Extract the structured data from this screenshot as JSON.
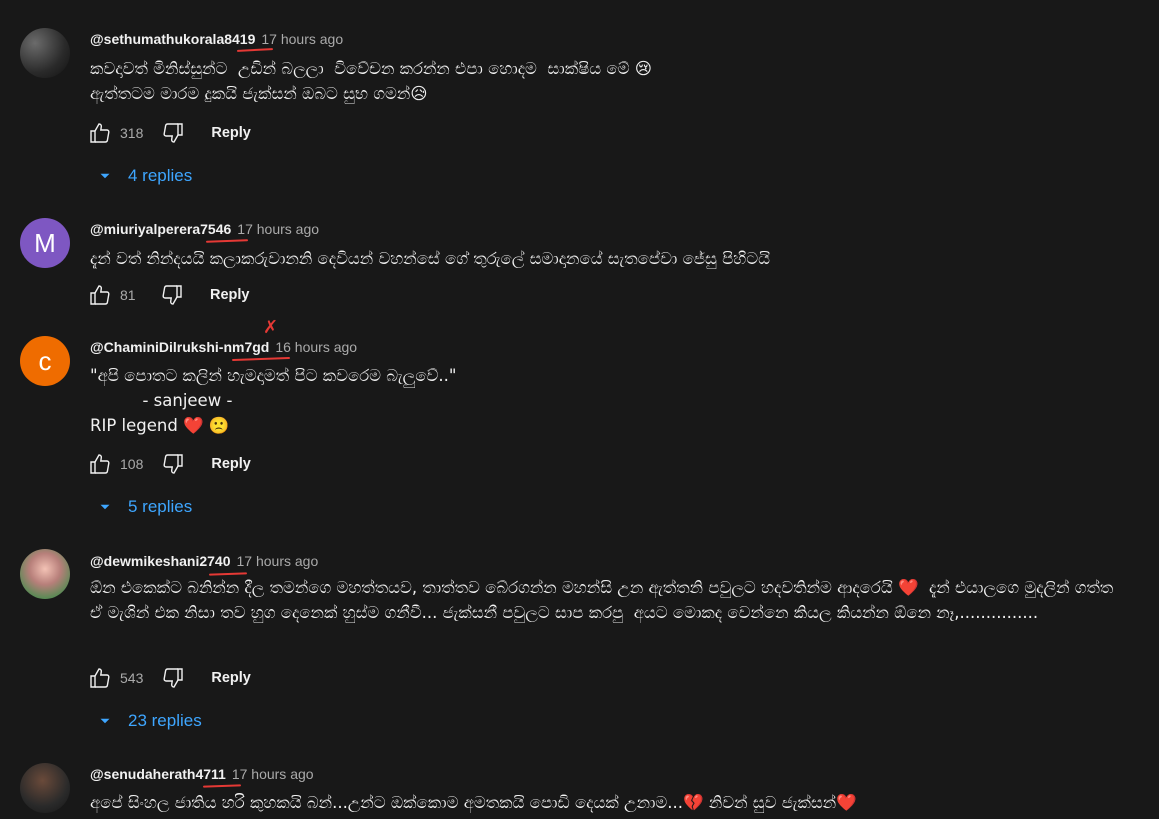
{
  "comments": [
    {
      "author": "@sethumathukorala8419",
      "time": "17 hours ago",
      "avatar_letter": "",
      "text": "කවදාවත් මිනිස්සුන්ට  උඩින් බලලා  විවේචන කරන්න එපා හොදම  සාක්ෂිය මේ 😢\nඇත්තටම මාරම දුකයි ජැක්සන් ඔබට සුභ ගමන්😥",
      "likes": "318",
      "reply_label": "Reply",
      "replies_label": "4 replies"
    },
    {
      "author": "@miuriyalperera7546",
      "time": "17 hours ago",
      "avatar_letter": "M",
      "avatar_color": "#7e57c2",
      "text": "දැන් වත් නින්දයයි කලාකරුවානනි දෙවියන් වහන්සේ ගේ තුරුලේ සමාදානයේ සැතපේවා ජේසු පිහිටයි",
      "likes": "81",
      "reply_label": "Reply",
      "replies_label": ""
    },
    {
      "author": "@ChaminiDilrukshi-nm7gd",
      "time": "16 hours ago",
      "avatar_letter": "C",
      "avatar_color": "#ef6c00",
      "text": "\"අපි පොතට කලින් හැමදාමත් පිට කවරෙම බැලුවේ..\"\n          - sanjeew -\nRIP legend ❤️ 🙁",
      "likes": "108",
      "reply_label": "Reply",
      "replies_label": "5 replies"
    },
    {
      "author": "@dewmikeshani2740",
      "time": "17 hours ago",
      "avatar_letter": "",
      "text": "ඕන එකෙක්ට බනින්න දීල තමන්ගෙ මහත්තයව, තාත්තව බේරගන්න මහන්සි උන ඇත්තනි පවුලට හදවතින්ම ආදරෙයි ❤️  දැන් එයාලගෙ මුදලින් ගත්ත ඒ මැශින් එක නිසා තව හුග දෙනෙක් හුස්ම ගනීවී... ජැක්සනී පවුලට සාප කරපු  අයට මොකද වෙන්නෙ කියල කියන්න ඕනෙ නෑ,...............",
      "likes": "543",
      "reply_label": "Reply",
      "replies_label": "23 replies"
    },
    {
      "author": "@senudaherath4711",
      "time": "17 hours ago",
      "avatar_letter": "",
      "text": "අපේ සිංහල ජාතිය හරි කුහකයි බන්...උන්ට ඔක්කොම අමතකයි පොඩි දෙයක් උනාම...💔 නිවන් සුව ජැක්සන්❤️",
      "likes": "",
      "reply_label": "",
      "replies_label": ""
    }
  ],
  "colors": {
    "background": "#181818",
    "author": "#f1f1f1",
    "time": "#aaaaaa",
    "replies_link": "#3ea6ff",
    "annotation": "#e53935"
  },
  "icons": [
    "thumb-up-icon",
    "thumb-down-icon",
    "chevron-down-icon"
  ]
}
